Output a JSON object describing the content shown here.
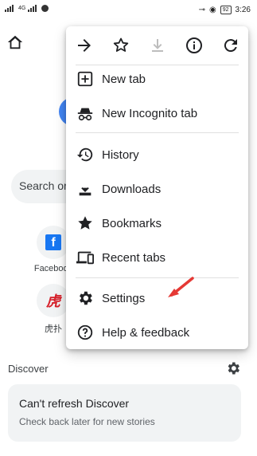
{
  "status": {
    "left": "4G",
    "time": "3:26",
    "battery": "92"
  },
  "page": {
    "search_text": "Search or",
    "tiles": [
      {
        "label": "Facebook",
        "glyph": "f"
      },
      {
        "label": "虎扑",
        "glyph": "虎"
      }
    ],
    "discover": {
      "title": "Discover",
      "card_title": "Can't refresh Discover",
      "card_subtitle": "Check back later for new stories"
    }
  },
  "menu": {
    "items": [
      {
        "label": "New tab",
        "icon": "new-tab-icon"
      },
      {
        "label": "New Incognito tab",
        "icon": "incognito-icon"
      },
      {
        "label": "History",
        "icon": "history-icon"
      },
      {
        "label": "Downloads",
        "icon": "download-icon"
      },
      {
        "label": "Bookmarks",
        "icon": "star-icon"
      },
      {
        "label": "Recent tabs",
        "icon": "devices-icon"
      },
      {
        "label": "Settings",
        "icon": "gear-icon"
      },
      {
        "label": "Help & feedback",
        "icon": "help-icon"
      }
    ]
  },
  "colors": {
    "accent": "#4285f4",
    "annotation": "#e53935"
  }
}
